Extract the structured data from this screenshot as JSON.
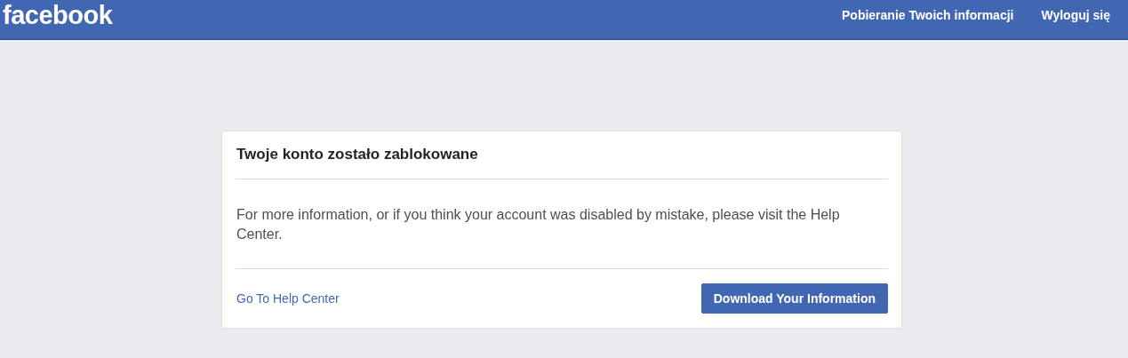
{
  "header": {
    "logo": "facebook",
    "links": [
      "Pobieranie Twoich informacji",
      "Wyloguj się"
    ]
  },
  "card": {
    "title": "Twoje konto zostało zablokowane",
    "message": "For more information, or if you think your account was disabled by mistake, please visit the Help Center.",
    "link": "Go To Help Center",
    "button": "Download Your Information"
  }
}
